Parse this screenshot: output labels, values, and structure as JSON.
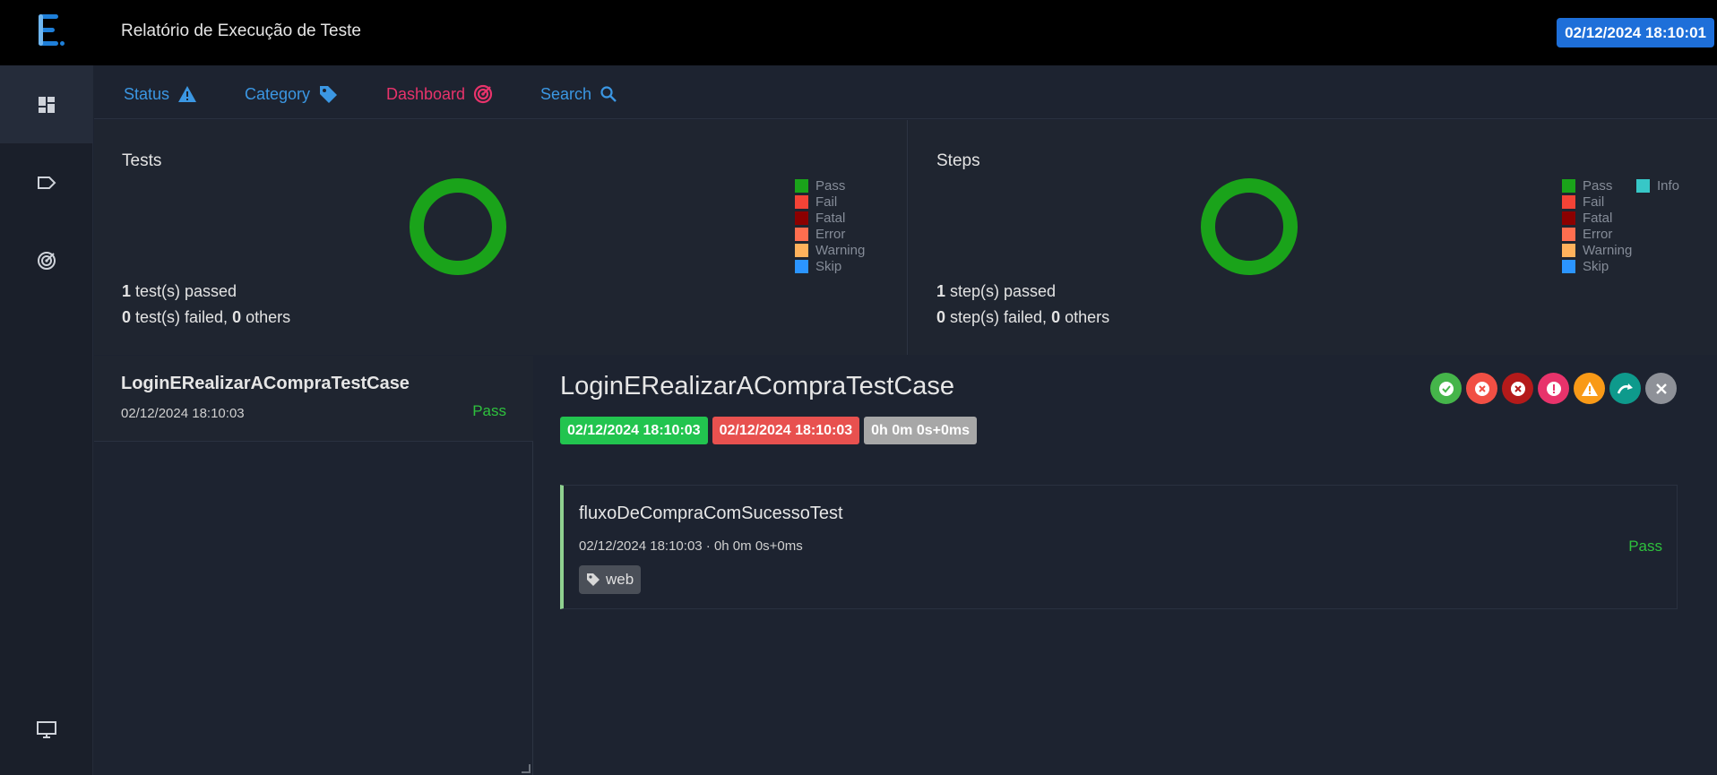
{
  "header": {
    "title": "Relatório de Execução de Teste",
    "date": "02/12/2024 18:10:01"
  },
  "sidebar": {
    "items": [
      {
        "icon": "dashboard-grid-icon"
      },
      {
        "icon": "tag-outline-icon"
      },
      {
        "icon": "radar-icon"
      },
      {
        "icon": "monitor-icon"
      }
    ]
  },
  "nav": {
    "status": "Status",
    "category": "Category",
    "dashboard": "Dashboard",
    "search": "Search"
  },
  "colors": {
    "pass": "#1aa31a",
    "fail": "#f44336",
    "fatal": "#8b0000",
    "error": "#ff6e4f",
    "warning": "#ffb25c",
    "skip": "#2b95ff",
    "info": "#37c7c7",
    "accent": "#1e6fd9",
    "dashboard": "#e8336b"
  },
  "tests_panel": {
    "title": "Tests",
    "legend": [
      "Pass",
      "Fail",
      "Fatal",
      "Error",
      "Warning",
      "Skip"
    ],
    "passed_count": "1",
    "passed_text": " test(s) passed",
    "failed_count": "0",
    "failed_text": " test(s) failed, ",
    "others_count": "0",
    "others_text": " others",
    "pass_fraction": 1.0
  },
  "steps_panel": {
    "title": "Steps",
    "legend": [
      "Pass",
      "Fail",
      "Fatal",
      "Error",
      "Warning",
      "Skip"
    ],
    "legend_extra": "Info",
    "passed_count": "1",
    "passed_text": " step(s) passed",
    "failed_count": "0",
    "failed_text": " step(s) failed, ",
    "others_count": "0",
    "others_text": " others",
    "pass_fraction": 1.0
  },
  "test_list": [
    {
      "name": "LoginERealizarACompraTestCase",
      "time": "02/12/2024 18:10:03",
      "status": "Pass"
    }
  ],
  "detail": {
    "title": "LoginERealizarACompraTestCase",
    "start": "02/12/2024 18:10:03",
    "end": "02/12/2024 18:10:03",
    "duration": "0h 0m 0s+0ms",
    "step": {
      "name": "fluxoDeCompraComSucessoTest",
      "meta": "02/12/2024 18:10:03 · 0h 0m 0s+0ms",
      "status": "Pass",
      "tag": "web"
    }
  }
}
